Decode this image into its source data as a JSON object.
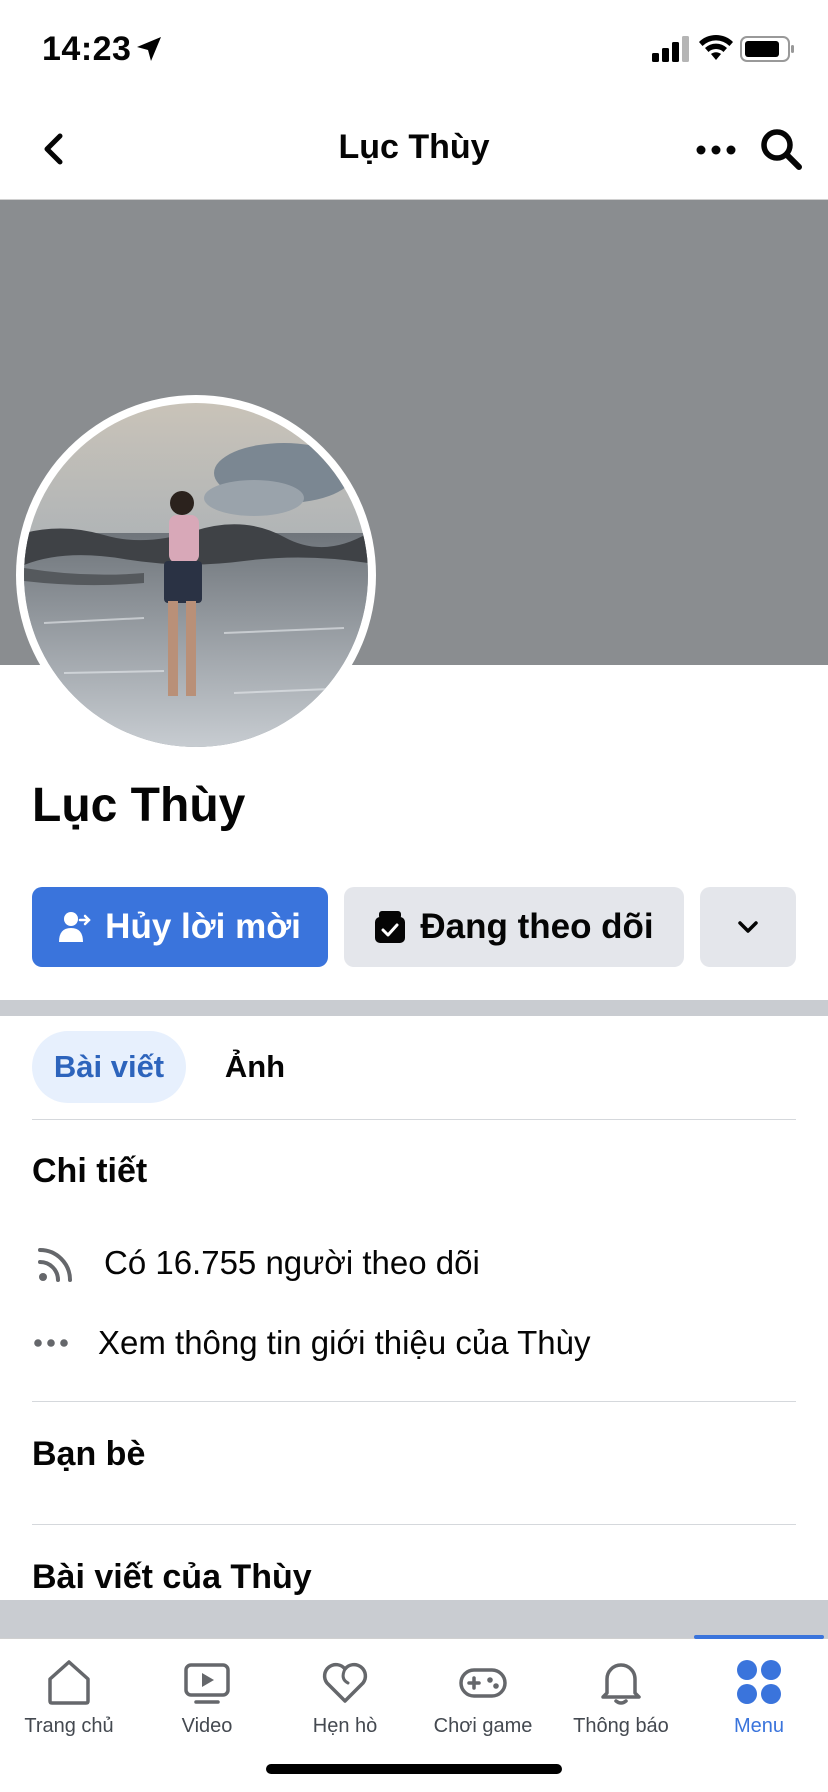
{
  "status_bar": {
    "time": "14:23",
    "icons": [
      "location-arrow-icon",
      "cellular-signal-icon",
      "wifi-icon",
      "battery-icon"
    ]
  },
  "nav": {
    "title": "Lục Thùy",
    "icons": [
      "back-chevron-icon",
      "more-dots-icon",
      "search-icon"
    ]
  },
  "profile": {
    "name": "Lục Thùy"
  },
  "actions": {
    "cancel_request_label": "Hủy lời mời",
    "following_label": "Đang theo dõi"
  },
  "tabs": [
    {
      "label": "Bài viết",
      "active": true
    },
    {
      "label": "Ảnh",
      "active": false
    }
  ],
  "details": {
    "title": "Chi tiết",
    "followers_text": "Có 16.755 người theo dõi",
    "about_text": "Xem thông tin giới thiệu của Thùy"
  },
  "friends": {
    "title": "Bạn bè"
  },
  "posts": {
    "title": "Bài viết của Thùy"
  },
  "tabbar": {
    "items": [
      {
        "label": "Trang chủ",
        "icon": "home-icon"
      },
      {
        "label": "Video",
        "icon": "video-icon"
      },
      {
        "label": "Hẹn hò",
        "icon": "dating-heart-icon"
      },
      {
        "label": "Chơi game",
        "icon": "gamepad-icon"
      },
      {
        "label": "Thông báo",
        "icon": "bell-icon"
      },
      {
        "label": "Menu",
        "icon": "menu-grid-icon",
        "active": true
      }
    ]
  },
  "colors": {
    "accent": "#3a74dc",
    "cover": "#8a8d90",
    "secondary_button": "#e4e6eb",
    "active_tab_bg": "#e7f0fd",
    "separator": "#c9ccd1"
  }
}
